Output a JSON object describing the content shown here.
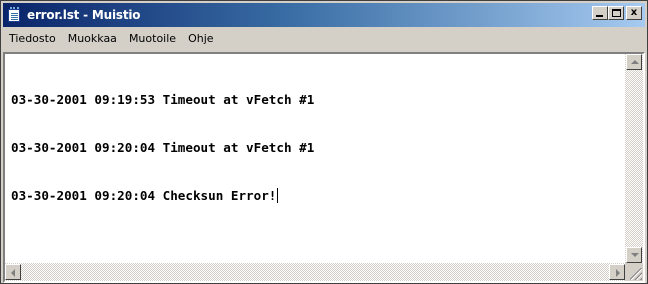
{
  "window": {
    "title": "error.lst - Muistio",
    "app_icon": "notepad-icon",
    "buttons": {
      "minimize": "minimize-icon",
      "maximize": "maximize-icon",
      "close_label": "x"
    }
  },
  "menu": {
    "items": [
      "Tiedosto",
      "Muokkaa",
      "Muotoile",
      "Ohje"
    ]
  },
  "editor": {
    "lines": [
      "03-30-2001 09:19:53 Timeout at vFetch #1",
      "03-30-2001 09:20:04 Timeout at vFetch #1",
      "03-30-2001 09:20:04 Checksun Error!"
    ]
  },
  "colors": {
    "title_gradient_start": "#0a246a",
    "title_gradient_end": "#a6caf0",
    "chrome": "#d4d0c8",
    "text": "#000000"
  }
}
